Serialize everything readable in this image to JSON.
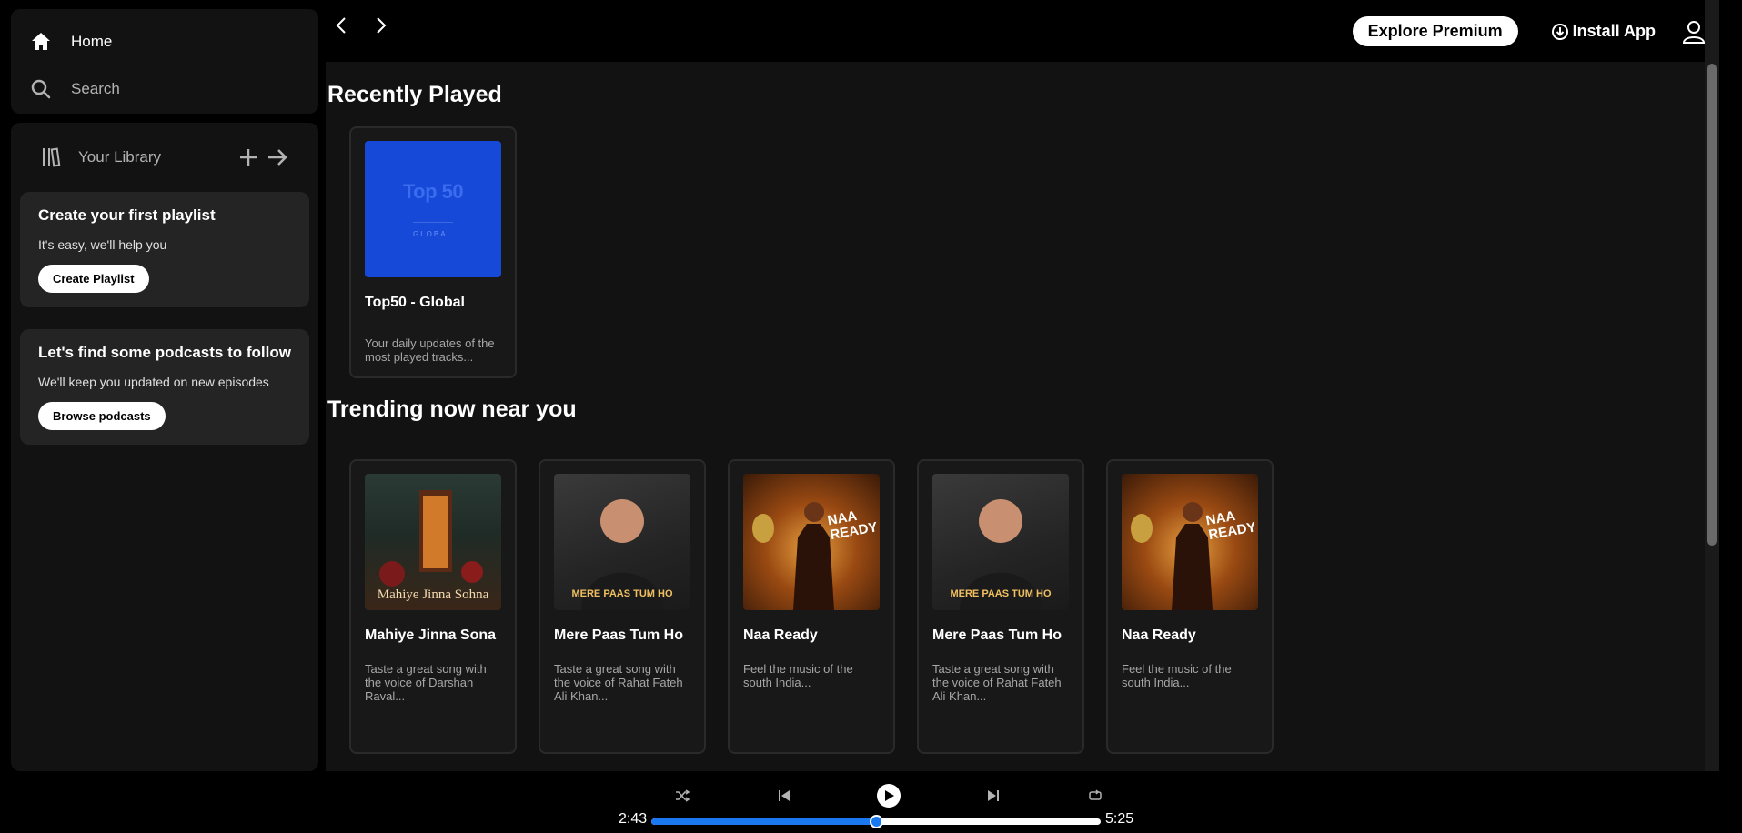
{
  "sidebar": {
    "home_label": "Home",
    "search_label": "Search",
    "library_label": "Your Library",
    "promos": [
      {
        "title": "Create your first playlist",
        "text": "It's easy, we'll help you",
        "button": "Create Playlist"
      },
      {
        "title": "Let's find some podcasts to follow",
        "text": "We'll keep you updated on new episodes",
        "button": "Browse podcasts"
      }
    ]
  },
  "header": {
    "premium_label": "Explore Premium",
    "install_label": "Install App"
  },
  "sections": {
    "recent": {
      "title": "Recently Played",
      "cards": [
        {
          "title": "Top50 - Global",
          "desc": "Your daily updates of the most played tracks...",
          "cover_title": "Top 50",
          "cover_sub": "GLOBAL"
        }
      ]
    },
    "trending": {
      "title": "Trending now near you",
      "cards": [
        {
          "title": "Mahiye Jinna Sona",
          "desc": "Taste a great song with the voice of Darshan Raval...",
          "cover_text": "Mahiye Jinna Sohna"
        },
        {
          "title": "Mere Paas Tum Ho",
          "desc": "Taste a great song with the voice of Rahat Fateh Ali Khan...",
          "cover_text": "MERE PAAS TUM HO"
        },
        {
          "title": "Naa Ready",
          "desc": "Feel the music of the south India...",
          "cover_text": "NAA READY"
        },
        {
          "title": "Mere Paas Tum Ho",
          "desc": "Taste a great song with the voice of Rahat Fateh Ali Khan...",
          "cover_text": "MERE PAAS TUM HO"
        },
        {
          "title": "Naa Ready",
          "desc": "Feel the music of the south India...",
          "cover_text": "NAA READY"
        }
      ]
    }
  },
  "player": {
    "current_time": "2:43",
    "total_time": "5:25",
    "progress": 0.5
  },
  "icons": [
    "home-icon",
    "search-icon",
    "library-icon",
    "plus-icon",
    "arrow-right-icon",
    "chevron-left-icon",
    "chevron-right-icon",
    "download-icon",
    "user-icon",
    "shuffle-icon",
    "previous-icon",
    "play-icon",
    "next-icon",
    "repeat-icon"
  ],
  "colors": {
    "accent": "#1a78f0",
    "top50_cover": "#1749d8"
  }
}
